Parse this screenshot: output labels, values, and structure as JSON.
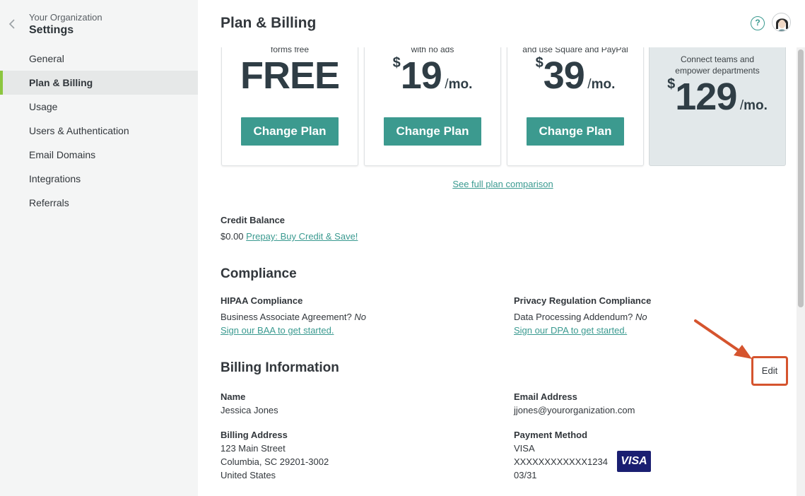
{
  "sidebar": {
    "org_name": "Your Organization",
    "title": "Settings",
    "items": [
      {
        "label": "General"
      },
      {
        "label": "Plan & Billing"
      },
      {
        "label": "Usage"
      },
      {
        "label": "Users & Authentication"
      },
      {
        "label": "Email Domains"
      },
      {
        "label": "Integrations"
      },
      {
        "label": "Referrals"
      }
    ],
    "active_item": "Plan & Billing"
  },
  "header": {
    "title": "Plan & Billing",
    "help_glyph": "?"
  },
  "plans": [
    {
      "desc": "forms free",
      "price": "FREE",
      "button": "Change Plan"
    },
    {
      "desc": "with no ads",
      "currency": "$",
      "amount": "19",
      "per": "/",
      "per_unit": "mo.",
      "button": "Change Plan"
    },
    {
      "desc": "and use Square and PayPal",
      "currency": "$",
      "amount": "39",
      "per": "/",
      "per_unit": "mo.",
      "button": "Change Plan"
    },
    {
      "desc_line1": "Connect teams and",
      "desc_line2": "empower departments",
      "currency": "$",
      "amount": "129",
      "per": "/",
      "per_unit": "mo."
    }
  ],
  "compare_link": "See full plan comparison",
  "credit": {
    "title": "Credit Balance",
    "amount": "$0.00",
    "link": "Prepay: Buy Credit & Save!"
  },
  "compliance": {
    "title": "Compliance",
    "hipaa": {
      "title": "HIPAA Compliance",
      "question": "Business Associate Agreement?",
      "answer": "No",
      "link": "Sign our BAA to get started."
    },
    "privacy": {
      "title": "Privacy Regulation Compliance",
      "question": "Data Processing Addendum?",
      "answer": "No",
      "link": "Sign our DPA to get started."
    }
  },
  "billing": {
    "title": "Billing Information",
    "edit_label": "Edit",
    "name_label": "Name",
    "name": "Jessica Jones",
    "email_label": "Email Address",
    "email": "jjones@yourorganization.com",
    "address_label": "Billing Address",
    "address_line1": "123 Main Street",
    "address_line2": "Columbia, SC 29201-3002",
    "address_line3": "United States",
    "payment_label": "Payment Method",
    "card_type": "VISA",
    "card_number": "XXXXXXXXXXXX1234",
    "card_exp": "03/31",
    "card_logo": "VISA"
  },
  "colors": {
    "accent": "#3c9a8f",
    "active_bar": "#8cc63f",
    "annotation": "#d5542e"
  }
}
